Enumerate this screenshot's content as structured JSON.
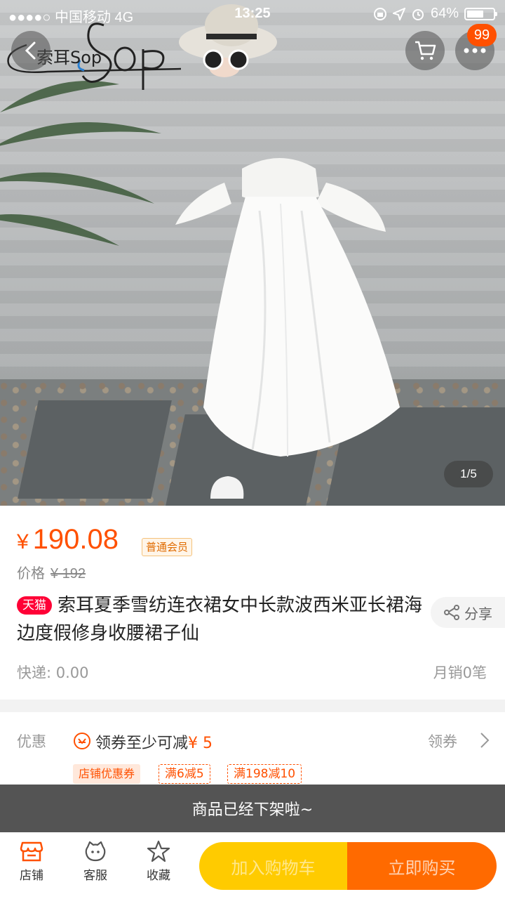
{
  "status_bar": {
    "carrier": "●●●●○ 中国移动  4G",
    "time": "13:25",
    "battery": "64%",
    "battery_level": 0.64
  },
  "header": {
    "brand_logo_text": "索耳Sop",
    "cart_badge": "99"
  },
  "gallery": {
    "pager": "1/5"
  },
  "product": {
    "currency": "¥",
    "price": "190.08",
    "member_tag": "普通会员",
    "original_price_label": "价格",
    "original_price": "¥ 192",
    "platform_tag": "天猫",
    "title": "索耳夏季雪纺连衣裙女中长款波西米亚长裙海边度假修身收腰裙子仙",
    "share_label": "分享",
    "shipping": "快递: 0.00",
    "monthly_sales": "月销0笔"
  },
  "promotions": {
    "label": "优惠",
    "coupon_text": "领券至少可减",
    "coupon_amount": "¥ 5",
    "get_coupon": "领券",
    "shop_coupon_tag": "店铺优惠券",
    "coupons": [
      "满6减5",
      "满198减10"
    ]
  },
  "notice": {
    "offline": "商品已经下架啦~"
  },
  "bottom_bar": {
    "shop": "店铺",
    "service": "客服",
    "favorite": "收藏",
    "add_to_cart": "加入购物车",
    "buy_now": "立即购买"
  },
  "colors": {
    "accent": "#ff5000",
    "tmall_red": "#ff0036",
    "cart_yellow": "#ffcb00",
    "buy_orange": "#ff6a00"
  }
}
